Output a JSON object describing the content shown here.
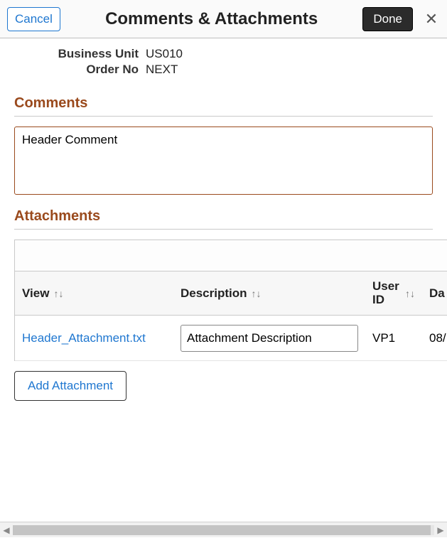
{
  "header": {
    "cancel_label": "Cancel",
    "title": "Comments & Attachments",
    "done_label": "Done",
    "close_glyph": "✕"
  },
  "info": {
    "business_unit_label": "Business Unit",
    "business_unit_value": "US010",
    "order_no_label": "Order No",
    "order_no_value": "NEXT"
  },
  "comments": {
    "heading": "Comments",
    "value": "Header Comment"
  },
  "attachments": {
    "heading": "Attachments",
    "columns": {
      "view": "View",
      "description": "Description",
      "user_id": "User ID",
      "date_partial": "Da"
    },
    "rows": [
      {
        "file_name": "Header_Attachment.txt",
        "description": "Attachment Description",
        "user_id": "VP1",
        "date_partial": "08/"
      }
    ],
    "add_button_label": "Add Attachment"
  },
  "glyphs": {
    "sort": "↑↓",
    "left": "◀",
    "right": "▶"
  }
}
